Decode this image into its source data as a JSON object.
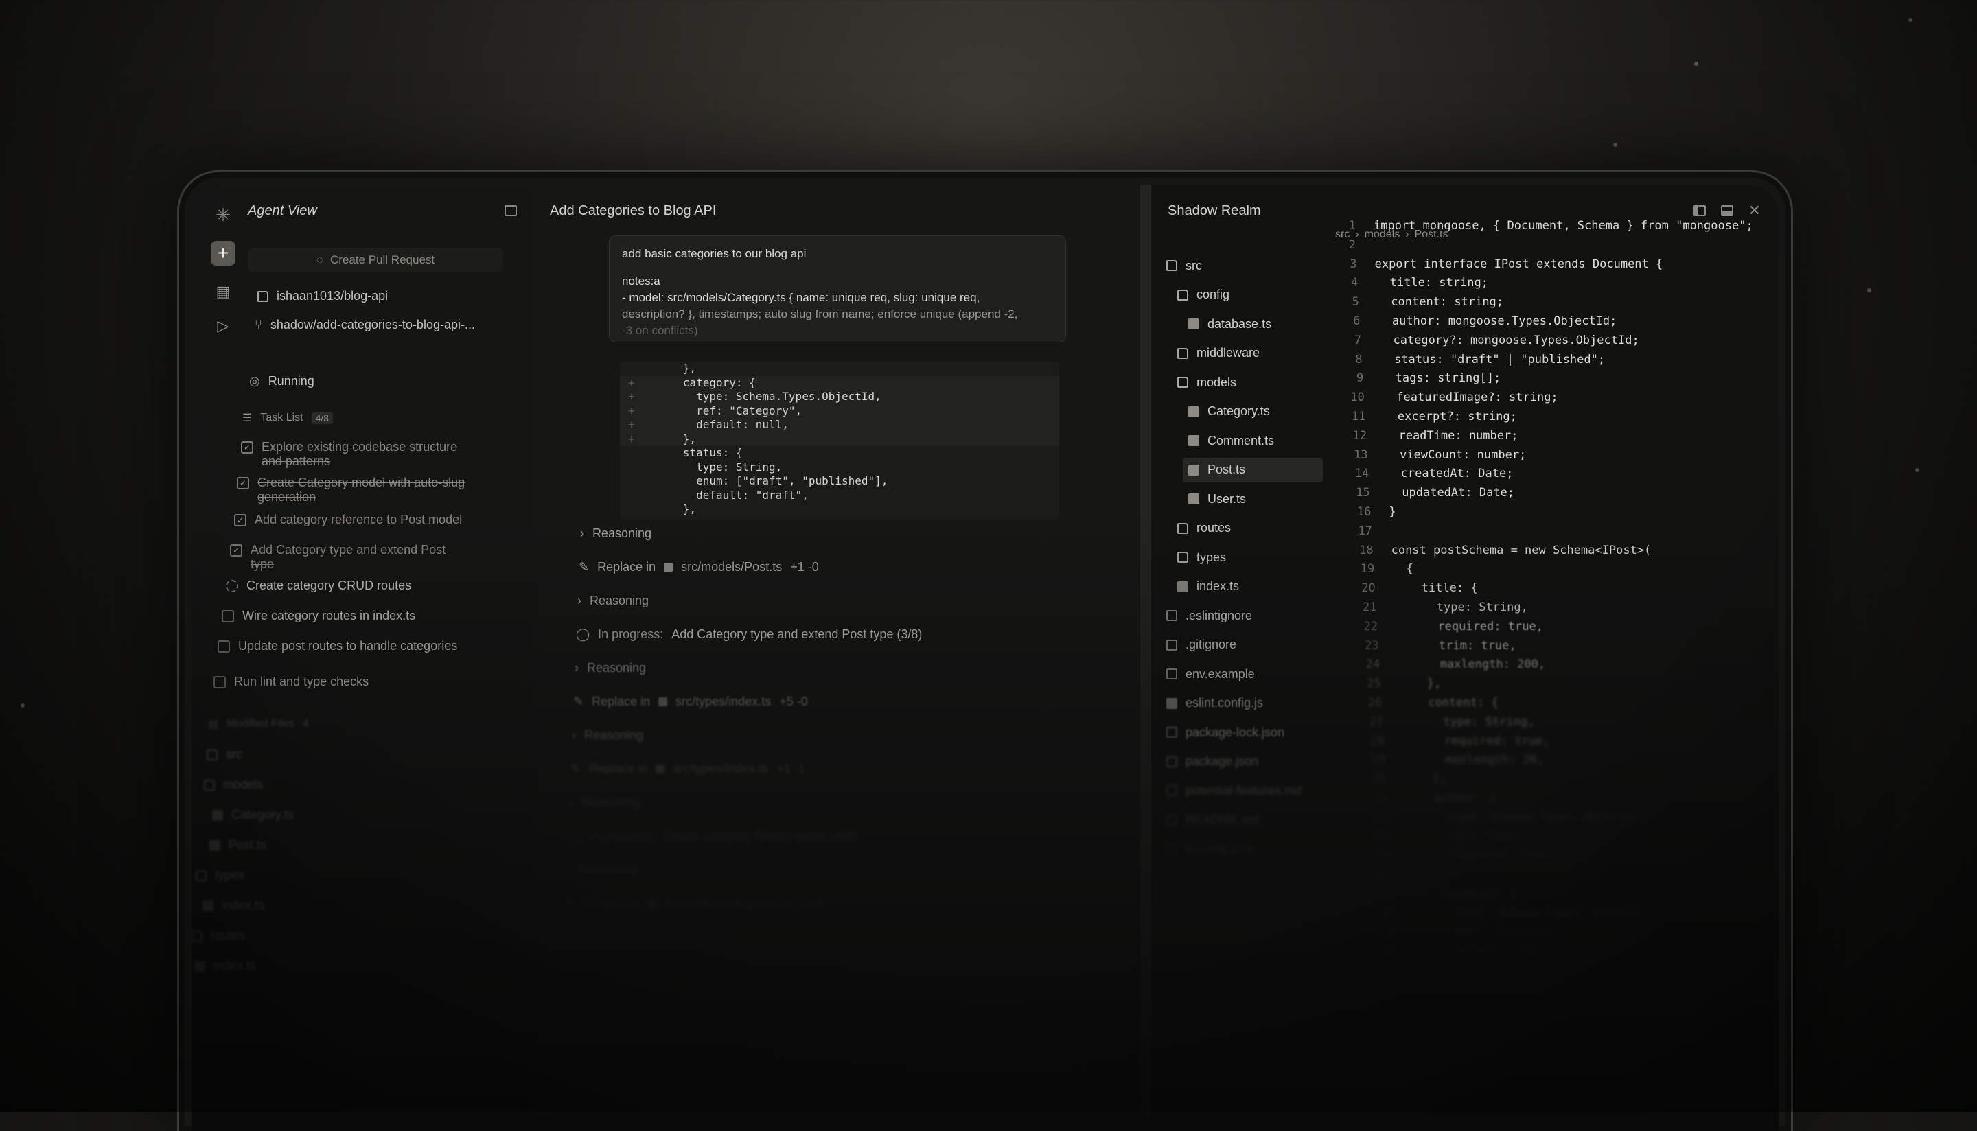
{
  "left_panel": {
    "title": "Agent View",
    "create_pr_label": "Create Pull Request",
    "repo": "ishaan1013/blog-api",
    "branch": "shadow/add-categories-to-blog-api-...",
    "status": "Running",
    "task_list_label": "Task List",
    "task_count": "4/8",
    "tasks": [
      {
        "text": "Explore existing codebase structure and patterns",
        "done": true
      },
      {
        "text": "Create Category model with auto-slug generation",
        "done": true
      },
      {
        "text": "Add category reference to Post model",
        "done": true
      },
      {
        "text": "Add Category type and extend Post type",
        "done": true
      },
      {
        "text": "Create category CRUD routes",
        "done": false,
        "in_progress": true
      },
      {
        "text": "Wire category routes in index.ts",
        "done": false
      },
      {
        "text": "Update post routes to handle categories",
        "done": false
      },
      {
        "text": "Run lint and type checks",
        "done": false
      }
    ],
    "modified_files_label": "Modified Files",
    "modified_files_count": "4",
    "modified_tree": [
      "src",
      "models",
      "Category.ts",
      "Post.ts",
      "types",
      "index.ts",
      "routes",
      "index.ts"
    ]
  },
  "middle_panel": {
    "title": "Add Categories to Blog API",
    "prompt_line1": "add basic categories to our blog api",
    "prompt_line2": "notes:a",
    "prompt_line3": "- model: src/models/Category.ts { name: unique req, slug: unique req,",
    "prompt_line4": "description? }, timestamps; auto slug from name; enforce unique (append -2,",
    "prompt_line5": "-3 on conflicts)",
    "diff_lines": [
      {
        "mark": "",
        "code": "      },"
      },
      {
        "mark": "+",
        "code": "      category: {"
      },
      {
        "mark": "+",
        "code": "        type: Schema.Types.ObjectId,"
      },
      {
        "mark": "+",
        "code": "        ref: \"Category\","
      },
      {
        "mark": "+",
        "code": "        default: null,"
      },
      {
        "mark": "+",
        "code": "      },"
      },
      {
        "mark": "",
        "code": "      status: {"
      },
      {
        "mark": "",
        "code": "        type: String,"
      },
      {
        "mark": "",
        "code": "        enum: [\"draft\", \"published\"],"
      },
      {
        "mark": "",
        "code": "        default: \"draft\","
      },
      {
        "mark": "",
        "code": "      },"
      }
    ],
    "steps": [
      {
        "kind": "reasoning",
        "text": "Reasoning"
      },
      {
        "kind": "replace",
        "text": "Replace in",
        "file": "src/models/Post.ts",
        "delta": "+1 -0"
      },
      {
        "kind": "reasoning",
        "text": "Reasoning"
      },
      {
        "kind": "progress",
        "text": "In progress:",
        "detail": "Add Category type and extend Post type (3/8)"
      },
      {
        "kind": "reasoning",
        "text": "Reasoning"
      },
      {
        "kind": "replace",
        "text": "Replace in",
        "file": "src/types/index.ts",
        "delta": "+5 -0"
      },
      {
        "kind": "reasoning",
        "text": "Reasoning"
      },
      {
        "kind": "replace",
        "text": "Replace in",
        "file": "src/types/index.ts",
        "delta": "+1 -1"
      },
      {
        "kind": "reasoning",
        "text": "Reasoning"
      },
      {
        "kind": "progress",
        "text": "In progress:",
        "detail": "Create category CRUD routes (4/8)"
      },
      {
        "kind": "reasoning",
        "text": "Reasoning"
      },
      {
        "kind": "replace",
        "text": "Create file",
        "file": "src/routes/categories.ts",
        "delta": "+58"
      }
    ]
  },
  "right_panel": {
    "title": "Shadow Realm",
    "breadcrumb": [
      "src",
      "models",
      "Post.ts"
    ],
    "tree": [
      {
        "name": "src",
        "type": "folder",
        "depth": 0
      },
      {
        "name": "config",
        "type": "folder",
        "depth": 1
      },
      {
        "name": "database.ts",
        "type": "file",
        "depth": 2
      },
      {
        "name": "middleware",
        "type": "folder",
        "depth": 1
      },
      {
        "name": "models",
        "type": "folder",
        "depth": 1
      },
      {
        "name": "Category.ts",
        "type": "file",
        "depth": 2
      },
      {
        "name": "Comment.ts",
        "type": "file",
        "depth": 2
      },
      {
        "name": "Post.ts",
        "type": "file",
        "depth": 2,
        "selected": true
      },
      {
        "name": "User.ts",
        "type": "file",
        "depth": 2
      },
      {
        "name": "routes",
        "type": "folder",
        "depth": 1
      },
      {
        "name": "types",
        "type": "folder",
        "depth": 1
      },
      {
        "name": "index.ts",
        "type": "file",
        "depth": 1
      },
      {
        "name": ".eslintignore",
        "type": "doc",
        "depth": 0
      },
      {
        "name": ".gitignore",
        "type": "git",
        "depth": 0
      },
      {
        "name": "env.example",
        "type": "doc",
        "depth": 0
      },
      {
        "name": "eslint.config.js",
        "type": "file",
        "depth": 0
      },
      {
        "name": "package-lock.json",
        "type": "json",
        "depth": 0
      },
      {
        "name": "package.json",
        "type": "json",
        "depth": 0
      },
      {
        "name": "potential-features.md",
        "type": "md",
        "depth": 0
      },
      {
        "name": "README.md",
        "type": "md",
        "depth": 0
      },
      {
        "name": "tsconfig.json",
        "type": "json",
        "depth": 0
      }
    ],
    "code_lines": [
      "import mongoose, { Document, Schema } from \"mongoose\";",
      "",
      "export interface IPost extends Document {",
      "  title: string;",
      "  content: string;",
      "  author: mongoose.Types.ObjectId;",
      "  category?: mongoose.Types.ObjectId;",
      "  status: \"draft\" | \"published\";",
      "  tags: string[];",
      "  featuredImage?: string;",
      "  excerpt?: string;",
      "  readTime: number;",
      "  viewCount: number;",
      "  createdAt: Date;",
      "  updatedAt: Date;",
      "}",
      "",
      "const postSchema = new Schema<IPost>(",
      "  {",
      "    title: {",
      "      type: String,",
      "      required: true,",
      "      trim: true,",
      "      maxlength: 200,",
      "    },",
      "    content: {",
      "      type: String,",
      "      required: true,",
      "      maxlength: 20,",
      "    },",
      "    author: {",
      "      type: Schema.Types.ObjectId,",
      "      ref: \"User\",",
      "      required: true,",
      "    },",
      "    category: {",
      "      type: Schema.Types.ObjectId,",
      "      ref: \"Category\",",
      "      default: null,"
    ]
  },
  "colors": {
    "accent": "#5a5954",
    "background": "#141413"
  }
}
